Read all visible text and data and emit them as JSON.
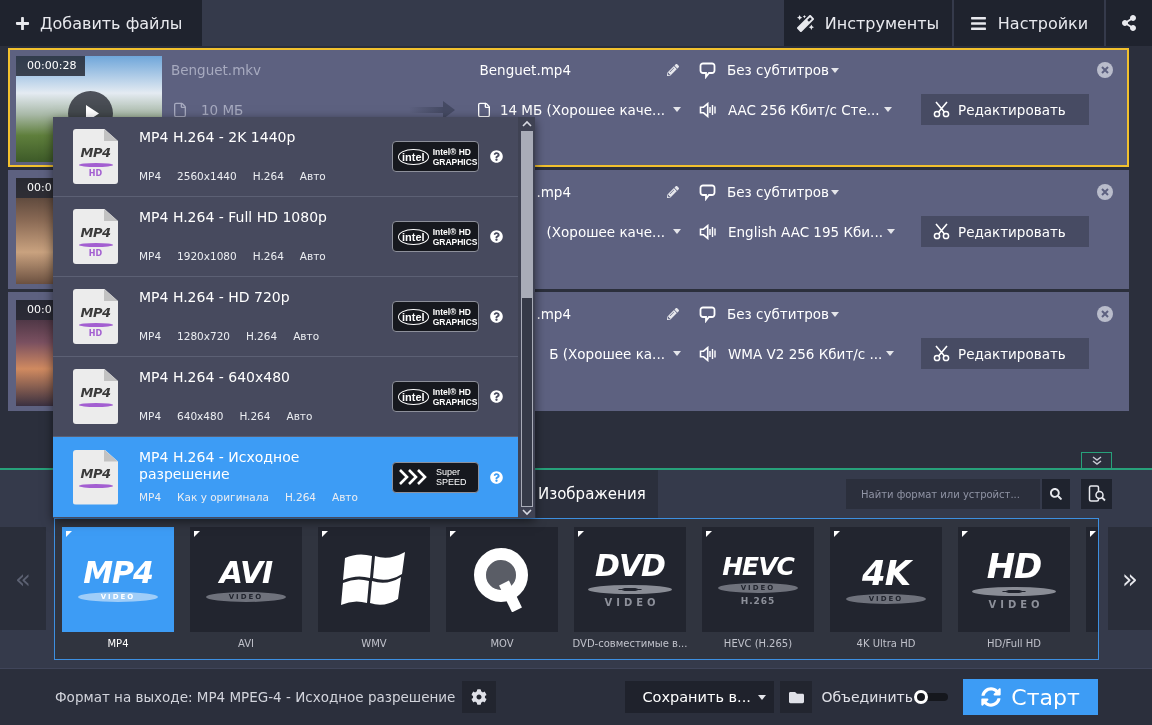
{
  "toolbar": {
    "add_files": "Добавить файлы",
    "buttons": [
      {
        "kind": "tools",
        "label": "Инструменты"
      },
      {
        "kind": "settings",
        "label": "Настройки"
      }
    ]
  },
  "files": [
    {
      "selected": true,
      "duration": "00:00:28",
      "source": {
        "name": "Benguet.mkv",
        "size": "10 МБ"
      },
      "output": {
        "name": "Benguet.mp4",
        "size": "14 МБ (Хорошее каче...",
        "subtitles": "Без субтитров",
        "audio": "AAC 256 Кбит/с Сте..."
      },
      "edit": "Редактировать"
    },
    {
      "selected": false,
      "duration": "00:0",
      "output": {
        "name": ".mp4",
        "size": "(Хорошее каче...",
        "subtitles": "Без субтитров",
        "audio": "English AAC 195 Кби..."
      },
      "edit": "Редактировать"
    },
    {
      "selected": false,
      "duration": "00:0",
      "output": {
        "name": ".mp4",
        "size": "Б (Хорошее ка...",
        "subtitles": "Без субтитров",
        "audio": "WMA V2 256 Кбит/с ..."
      },
      "edit": "Редактировать"
    }
  ],
  "format_menu": {
    "items": [
      {
        "title": "MP4 H.264 - 2K 1440p",
        "specs": [
          "MP4",
          "2560x1440",
          "H.264",
          "Авто"
        ],
        "icon": {
          "text": "MP4",
          "sub": "HD"
        },
        "accel": {
          "kind": "intel",
          "logo": "intel",
          "lines": [
            "Intel® HD",
            "GRAPHICS"
          ]
        },
        "selected": false
      },
      {
        "title": "MP4 H.264 - Full HD 1080p",
        "specs": [
          "MP4",
          "1920x1080",
          "H.264",
          "Авто"
        ],
        "icon": {
          "text": "MP4",
          "sub": "HD"
        },
        "accel": {
          "kind": "intel",
          "logo": "intel",
          "lines": [
            "Intel® HD",
            "GRAPHICS"
          ]
        },
        "selected": false
      },
      {
        "title": "MP4 H.264 - HD 720p",
        "specs": [
          "MP4",
          "1280x720",
          "H.264",
          "Авто"
        ],
        "icon": {
          "text": "MP4",
          "sub": "HD"
        },
        "accel": {
          "kind": "intel",
          "logo": "intel",
          "lines": [
            "Intel® HD",
            "GRAPHICS"
          ]
        },
        "selected": false
      },
      {
        "title": "MP4 H.264 - 640x480",
        "specs": [
          "MP4",
          "640x480",
          "H.264",
          "Авто"
        ],
        "icon": {
          "text": "MP4"
        },
        "accel": {
          "kind": "intel",
          "logo": "intel",
          "lines": [
            "Intel® HD",
            "GRAPHICS"
          ]
        },
        "selected": false
      },
      {
        "title": "MP4 H.264 - Исходное разрешение",
        "specs": [
          "MP4",
          "Как у оригинала",
          "H.264",
          "Авто"
        ],
        "icon": {
          "text": "MP4"
        },
        "accel": {
          "kind": "superspeed",
          "lines": [
            "Super",
            "SPEED"
          ]
        },
        "selected": true
      }
    ]
  },
  "format_tabs": [
    {
      "label": "Изображения",
      "selected": true
    }
  ],
  "search": {
    "placeholder": "Найти формат или устройст..."
  },
  "carousel": {
    "prev": {
      "label": "«",
      "disabled": true
    },
    "next": {
      "label": "»",
      "disabled": false
    },
    "formats": [
      {
        "label": "MP4",
        "selected": true,
        "logo": {
          "kind": "band",
          "text": "MP4",
          "band": "VIDEO"
        }
      },
      {
        "label": "AVI",
        "selected": false,
        "logo": {
          "kind": "band",
          "text": "AVI",
          "band": "VIDEO"
        }
      },
      {
        "label": "WMV",
        "selected": false,
        "logo": {
          "kind": "windows"
        }
      },
      {
        "label": "MOV",
        "selected": false,
        "logo": {
          "kind": "quicktime"
        }
      },
      {
        "label": "DVD-совместимые в...",
        "selected": false,
        "logo": {
          "kind": "disc",
          "text": "DVD",
          "band": "VIDEO"
        }
      },
      {
        "label": "HEVC (H.265)",
        "selected": false,
        "logo": {
          "kind": "band",
          "text": "HEVC",
          "band": "VIDEO",
          "sub": "H.265"
        }
      },
      {
        "label": "4K Ultra HD",
        "selected": false,
        "logo": {
          "kind": "band",
          "text": "4K",
          "band": "VIDEO"
        }
      },
      {
        "label": "HD/Full HD",
        "selected": false,
        "logo": {
          "kind": "disc",
          "text": "HD",
          "band": "VIDEO"
        }
      }
    ]
  },
  "bottom_bar": {
    "output_format": "Формат на выходе: MP4 MPEG-4 - Исходное разрешение",
    "save_to": "Сохранить в...",
    "merge": {
      "label": "Объединить",
      "on": false
    },
    "start": "Старт"
  }
}
